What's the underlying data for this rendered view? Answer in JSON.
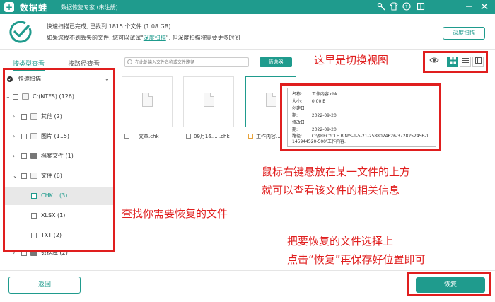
{
  "titlebar": {
    "logo_char": "+",
    "app_name": "数据蛙",
    "subtitle": "数据恢复专家 (未注册)",
    "controls": [
      "key",
      "tshirt",
      "help",
      "bookmark",
      "minimize",
      "close"
    ]
  },
  "scan_status": {
    "line1": "快速扫描已完成, 已找到 1815 个文件 (1.08 GB)",
    "line2_prefix": "如果您找不到丢失的文件, 您可以试试\"",
    "line2_link": "深度扫描",
    "line2_suffix": "\", 但深度扫描将需要更多时间",
    "deep_scan_button": "深度扫描"
  },
  "sidebar": {
    "tab_type": "按类型查看",
    "tab_path": "按路径查看",
    "quick_scan_label": "快速扫描",
    "drive": "C:(NTFS) (126)",
    "items": [
      {
        "label": "其他 (2)"
      },
      {
        "label": "图片 (115)"
      },
      {
        "label": "档案文件 (1)"
      },
      {
        "label": "文件 (6)"
      },
      {
        "label": "CHK",
        "count": "(3)"
      },
      {
        "label": "XLSX (1)"
      },
      {
        "label": "TXT (2)"
      },
      {
        "label": "数据库 (2)"
      }
    ]
  },
  "toolbar": {
    "search_placeholder": "在此处输入文件名称或文件路径",
    "filter_button": "筛选器"
  },
  "files": [
    {
      "name": "文章.chk"
    },
    {
      "name": "09月16.... .chk"
    },
    {
      "name": "工作内容...."
    }
  ],
  "tooltip": {
    "name_key": "名称:",
    "name_val": "工作内容.chk",
    "size_key": "大小:",
    "size_val": "0.00 B",
    "created_key": "创建日期:",
    "created_val": "2022-09-20",
    "modified_key": "修改日期:",
    "modified_val": "2022-09-20",
    "path_key": "路径:",
    "path_val": "C:\\$RECYCLE.BIN\\S-1-5-21-2588024626-3728252456-1145944520-500\\工作内容."
  },
  "view_buttons": [
    "eye-icon",
    "grid-icon",
    "list-icon",
    "detail-icon"
  ],
  "bottom": {
    "back_button": "返回",
    "recover_button": "恢复"
  },
  "annotations": {
    "switch_view": "这里是切换视图",
    "hover_line1": "鼠标右键悬放在某一文件的上方",
    "hover_line2": "就可以查看该文件的相关信息",
    "find_files": "查找你需要恢复的文件",
    "select_line1": "把要恢复的文件选择上",
    "select_line2": "点击“恢复”再保存好位置即可"
  },
  "colors": {
    "accent": "#1f9b8d",
    "annotation_red": "#e01e1e"
  }
}
